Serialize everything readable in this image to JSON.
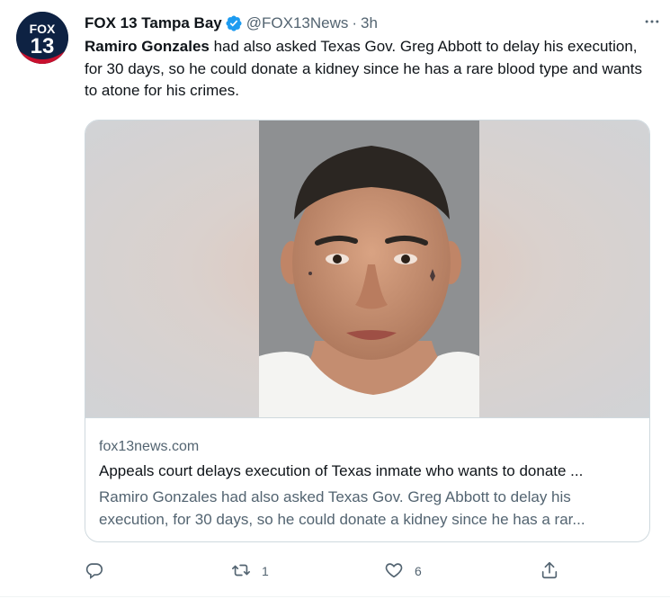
{
  "author": {
    "display_name": "FOX 13 Tampa Bay",
    "handle": "@FOX13News",
    "separator": "·",
    "time": "3h",
    "avatar_logo_top": "FOX",
    "avatar_logo_bottom": "13",
    "verified": true
  },
  "tweet": {
    "text_bold": "Ramiro Gonzales",
    "text_rest": " had also asked Texas Gov. Greg Abbott to delay his execution, for 30 days, so he could donate a kidney since he has a rare blood type and wants to atone for his crimes."
  },
  "card": {
    "image_description": "mugshot",
    "domain": "fox13news.com",
    "title": "Appeals court delays execution of Texas inmate who wants to donate ...",
    "description": "Ramiro Gonzales had also asked Texas Gov. Greg Abbott to delay his execution, for 30 days, so he could donate a kidney since he has a rar..."
  },
  "actions": {
    "reply_count": "",
    "retweet_count": "1",
    "like_count": "6",
    "share_count": ""
  },
  "icons": {
    "more": "more-horizontal-icon",
    "reply": "reply-icon",
    "retweet": "retweet-icon",
    "like": "heart-icon",
    "share": "share-icon",
    "verified": "verified-badge-icon"
  },
  "colors": {
    "verified_blue": "#1d9bf0",
    "text_primary": "#0f1419",
    "text_secondary": "#536471",
    "border": "#cfd9de",
    "avatar_bg": "#0e2243",
    "avatar_accent": "#c8102e"
  }
}
